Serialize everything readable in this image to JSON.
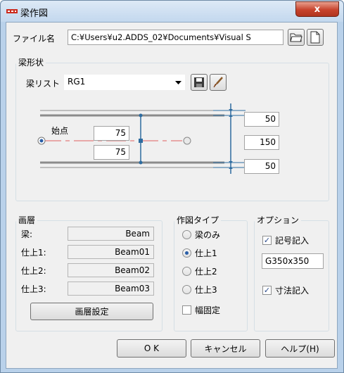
{
  "window": {
    "title": "梁作図",
    "close_glyph": "x"
  },
  "file": {
    "label": "ファイル名",
    "value": "C:¥Users¥u2.ADDS_02¥Documents¥Visual S"
  },
  "beam_shape": {
    "group_title": "梁形状",
    "list_label": "梁リスト",
    "list_value": "RG1",
    "start_label": "始点",
    "top_width": "75",
    "bottom_width": "75",
    "dim_top": "50",
    "dim_mid": "150",
    "dim_bottom": "50"
  },
  "layers": {
    "group_title": "画層",
    "beam_label": "梁:",
    "beam_value": "Beam",
    "finish1_label": "仕上1:",
    "finish1_value": "Beam01",
    "finish2_label": "仕上2:",
    "finish2_value": "Beam02",
    "finish3_label": "仕上3:",
    "finish3_value": "Beam03",
    "settings_button": "画層設定"
  },
  "draw_type": {
    "group_title": "作図タイプ",
    "options": [
      "梁のみ",
      "仕上1",
      "仕上2",
      "仕上3"
    ],
    "selected_index": 1,
    "fixed_width_label": "幅固定",
    "fixed_width_checked": false
  },
  "options": {
    "group_title": "オプション",
    "symbol_label": "記号記入",
    "symbol_checked": true,
    "symbol_value": "G350x350",
    "dimension_label": "寸法記入",
    "dimension_checked": true
  },
  "buttons": {
    "ok": "O K",
    "cancel": "キャンセル",
    "help": "ヘルプ(H)"
  },
  "colors": {
    "title_bar": "#c3d8ee",
    "close_button": "#c7432d",
    "dialog_bg": "#f0f0f0",
    "diagram_blue": "#2d6b9f",
    "diagram_red": "#e06060"
  }
}
